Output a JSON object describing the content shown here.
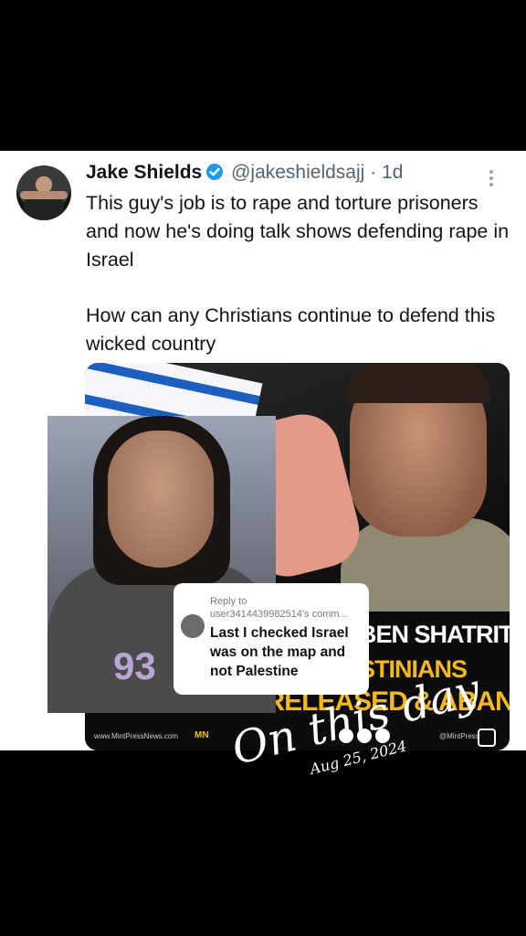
{
  "tweet": {
    "author_name": "Jake Shields",
    "author_handle": "@jakeshieldsajj",
    "separator": "·",
    "age": "1d",
    "text_line1": "This guy's job is to rape and torture prisoners and now he's doing talk shows defending rape in Israel",
    "text_line2": "How can any Christians continue to defend this wicked country"
  },
  "media": {
    "headline_1": "BEN SHATRIT",
    "headline_2": "STINIANS",
    "headline_3": "IMMEDIATELY RELEASED & ABANDONED",
    "site": "www.MintPressNews.com",
    "mark": "MN",
    "footer_handle": "@MintPress"
  },
  "overlay": {
    "jersey_number": "93",
    "reply_label": "Reply to",
    "reply_user": "user3414439982514's comm...",
    "reply_text": "Last I checked Israel was on the map and not Palestine"
  },
  "memory": {
    "title": "On this day",
    "date": "Aug 25, 2024"
  },
  "colors": {
    "verified": "#1d9bf0",
    "headline_yellow": "#f5b91a"
  }
}
